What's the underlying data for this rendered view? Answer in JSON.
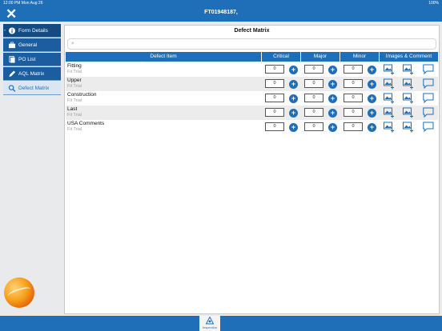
{
  "status": {
    "time_date": "12:00 PM   Mon Aug 26",
    "battery": "100%"
  },
  "header": {
    "title": "FT01948187,"
  },
  "sidebar": {
    "items": [
      {
        "label": "Form Details",
        "icon": "info-icon"
      },
      {
        "label": "General",
        "icon": "briefcase-icon"
      },
      {
        "label": "PO List",
        "icon": "document-icon"
      },
      {
        "label": "AQL Matrix",
        "icon": "pencil-icon"
      },
      {
        "label": "Defect Matrix",
        "icon": "search-icon"
      }
    ]
  },
  "main": {
    "title": "Defect Matrix",
    "search": {
      "placeholder": ""
    },
    "columns": [
      "Defect Item",
      "Critical",
      "Major",
      "Minor",
      "Images & Comment"
    ],
    "rows": [
      {
        "name": "Fitting",
        "sub": "Fit Trial",
        "critical": "0",
        "major": "0",
        "minor": "0"
      },
      {
        "name": "Upper",
        "sub": "Fit Trial",
        "critical": "0",
        "major": "0",
        "minor": "0"
      },
      {
        "name": "Construction",
        "sub": "Fit Trial",
        "critical": "0",
        "major": "0",
        "minor": "0"
      },
      {
        "name": "Last",
        "sub": "Fit Trial",
        "critical": "0",
        "major": "0",
        "minor": "0"
      },
      {
        "name": "USA Comments",
        "sub": "Fit Trial",
        "critical": "0",
        "major": "0",
        "minor": "0"
      }
    ]
  },
  "bottom": {
    "tab_label": "Inspection"
  },
  "colors": {
    "accent": "#1e6fb8",
    "sidebar_active": "#d9e6f4",
    "row_alt": "#ececec"
  }
}
